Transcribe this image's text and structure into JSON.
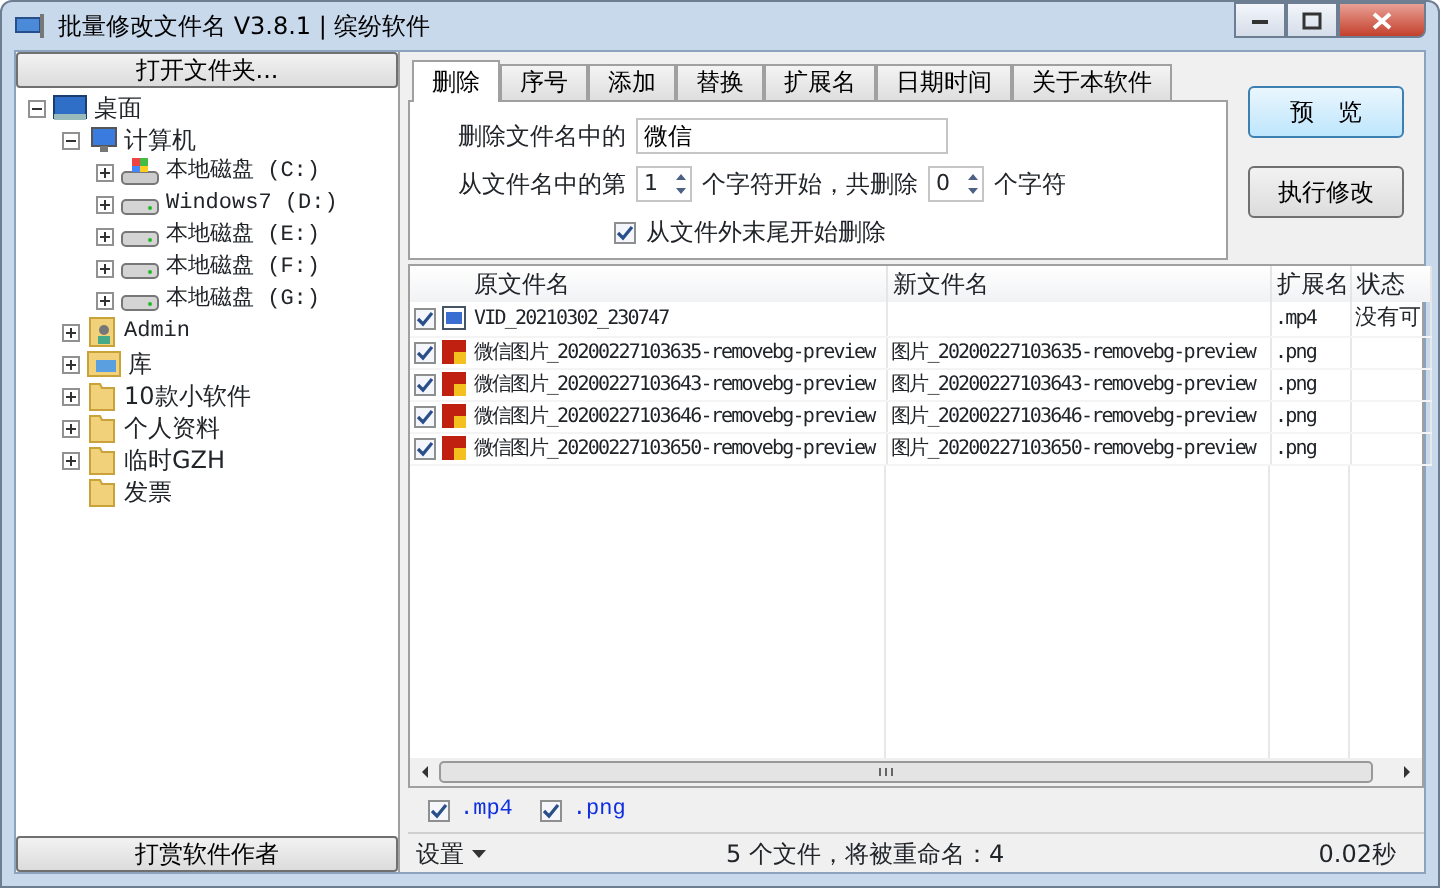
{
  "window": {
    "title": "批量修改文件名 V3.8.1 | 缤纷软件"
  },
  "sidebar": {
    "open_button": "打开文件夹...",
    "tree": [
      {
        "label": "桌面",
        "kind": "desktop",
        "expanded": true,
        "children": [
          {
            "label": "计算机",
            "kind": "computer",
            "expanded": true,
            "children": [
              {
                "label": "本地磁盘 (C:)",
                "kind": "system-drive",
                "expanded": false
              },
              {
                "label": "Windows7 (D:)",
                "kind": "drive",
                "expanded": false
              },
              {
                "label": "本地磁盘 (E:)",
                "kind": "drive",
                "expanded": false
              },
              {
                "label": "本地磁盘 (F:)",
                "kind": "drive",
                "expanded": false
              },
              {
                "label": "本地磁盘 (G:)",
                "kind": "drive",
                "expanded": false
              }
            ]
          },
          {
            "label": "Admin",
            "kind": "user",
            "expanded": false
          },
          {
            "label": "库",
            "kind": "library",
            "expanded": false
          },
          {
            "label": "10款小软件",
            "kind": "folder",
            "expanded": false
          },
          {
            "label": "个人资料",
            "kind": "folder",
            "expanded": false
          },
          {
            "label": "临时GZH",
            "kind": "folder",
            "expanded": false
          },
          {
            "label": "发票",
            "kind": "folder"
          }
        ]
      }
    ],
    "tip_button": "打赏软件作者"
  },
  "tabs": [
    {
      "label": "删除",
      "selected": true
    },
    {
      "label": "序号",
      "selected": false
    },
    {
      "label": "添加",
      "selected": false
    },
    {
      "label": "替换",
      "selected": false
    },
    {
      "label": "扩展名",
      "selected": false
    },
    {
      "label": "日期时间",
      "selected": false
    },
    {
      "label": "关于本软件",
      "selected": false
    }
  ],
  "delete_panel": {
    "text_label": "删除文件名中的",
    "text_value": "微信",
    "start_label": "从文件名中的第",
    "start_value": "1",
    "mid_label": "个字符开始，共删除",
    "count_value": "0",
    "end_label": "个字符",
    "from_end": {
      "label": "从文件外末尾开始删除",
      "checked": true
    }
  },
  "buttons": [
    "预　览",
    "执行修改"
  ],
  "table": {
    "columns": [
      "原文件名",
      "新文件名",
      "扩展名",
      "状态"
    ],
    "rows": [
      {
        "checked": true,
        "kind": "video",
        "original": "VID_20210302_230747",
        "new": "",
        "ext": ".mp4",
        "status": "没有可"
      },
      {
        "checked": true,
        "kind": "image",
        "original": "微信图片_20200227103635-removebg-preview",
        "new": "图片_20200227103635-removebg-preview",
        "ext": ".png",
        "status": ""
      },
      {
        "checked": true,
        "kind": "image",
        "original": "微信图片_20200227103643-removebg-preview",
        "new": "图片_20200227103643-removebg-preview",
        "ext": ".png",
        "status": ""
      },
      {
        "checked": true,
        "kind": "image",
        "original": "微信图片_20200227103646-removebg-preview",
        "new": "图片_20200227103646-removebg-preview",
        "ext": ".png",
        "status": ""
      },
      {
        "checked": true,
        "kind": "image",
        "original": "微信图片_20200227103650-removebg-preview",
        "new": "图片_20200227103650-removebg-preview",
        "ext": ".png",
        "status": ""
      }
    ]
  },
  "filters": [
    {
      "label": ".mp4",
      "checked": true
    },
    {
      "label": ".png",
      "checked": true
    }
  ],
  "status_bar": {
    "settings": "设置",
    "message": "5 个文件，将被重命名：4",
    "time": "0.02秒"
  }
}
